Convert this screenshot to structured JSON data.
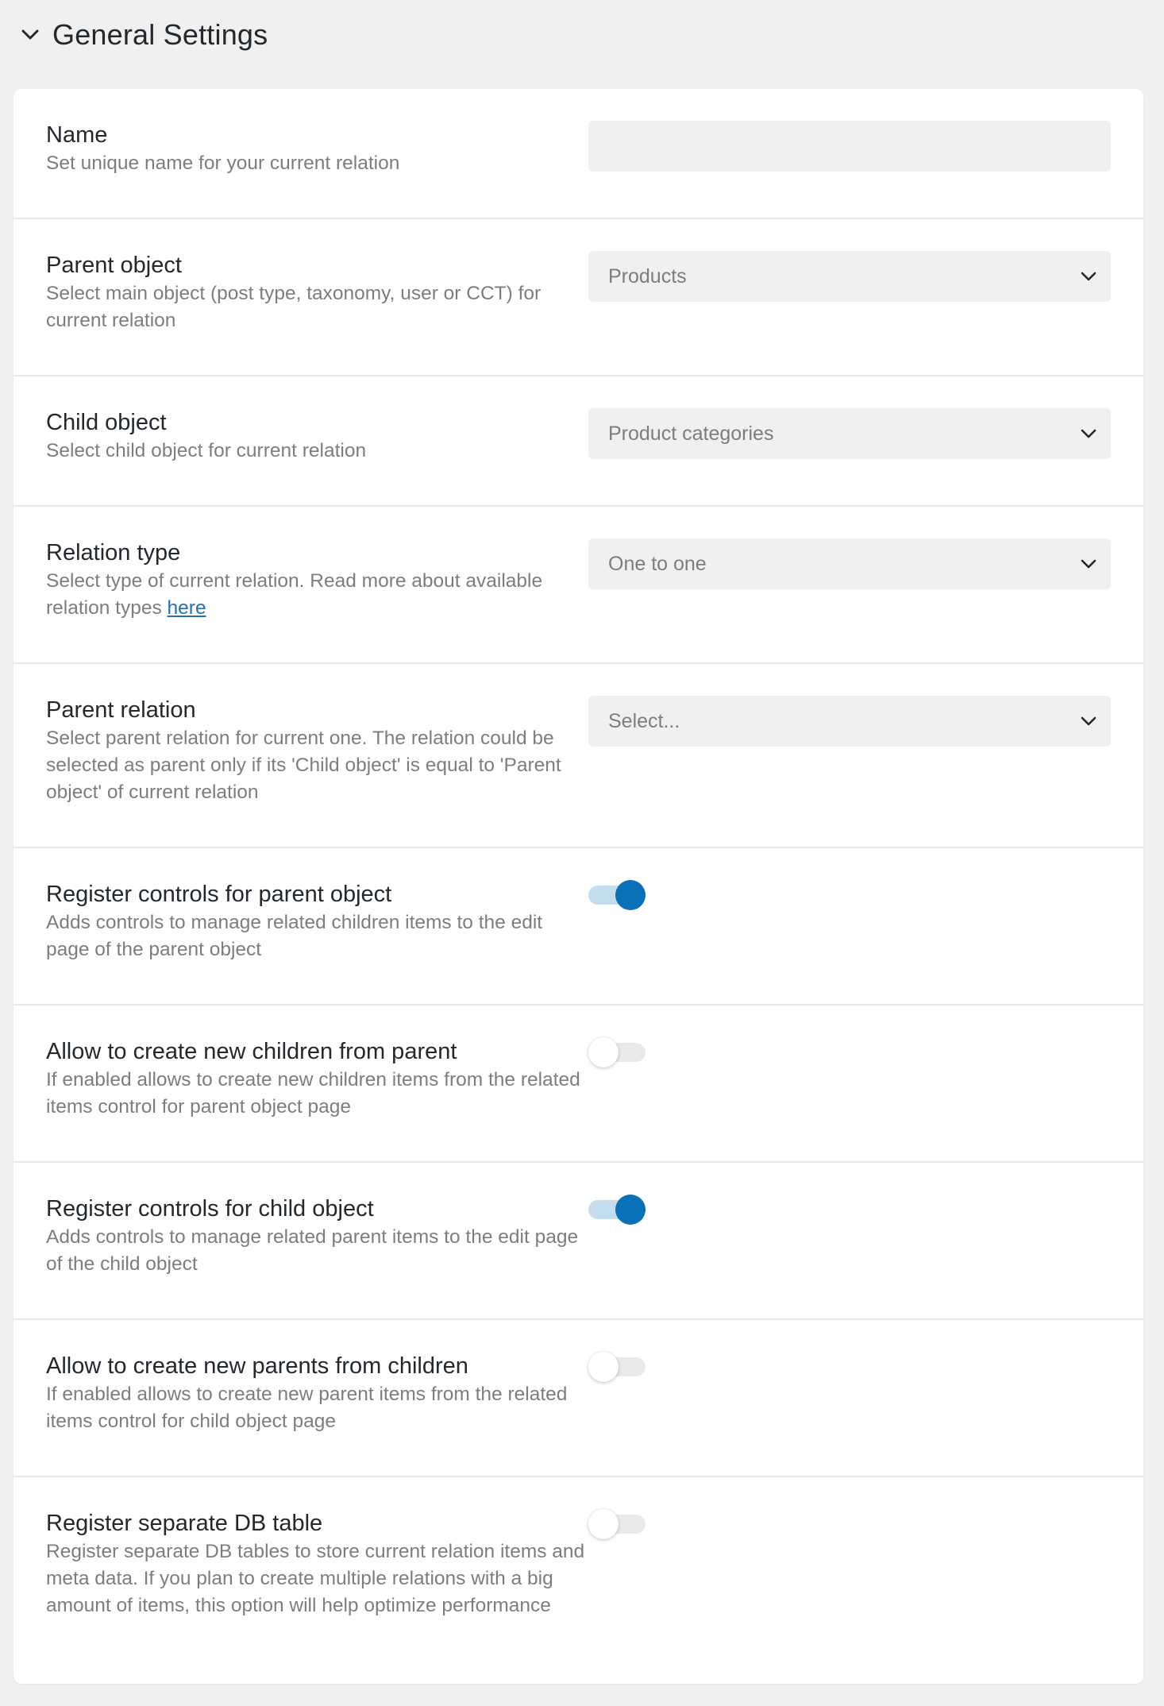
{
  "section": {
    "title": "General Settings"
  },
  "fields": {
    "name": {
      "title": "Name",
      "description": "Set unique name for your current relation",
      "value": ""
    },
    "parent_object": {
      "title": "Parent object",
      "description": "Select main object (post type, taxonomy, user or CCT) for current relation",
      "selected": "Products"
    },
    "child_object": {
      "title": "Child object",
      "description": "Select child object for current relation",
      "selected": "Product categories"
    },
    "relation_type": {
      "title": "Relation type",
      "description": "Select type of current relation. Read more about available relation types",
      "link_text": "here",
      "selected": "One to one"
    },
    "parent_relation": {
      "title": "Parent relation",
      "description": "Select parent relation for current one. The relation could be selected as parent only if its 'Child object' is equal to 'Parent object' of current relation",
      "selected": "Select..."
    },
    "register_parent_controls": {
      "title": "Register controls for parent object",
      "description": "Adds controls to manage related children items to the edit page of the parent object",
      "enabled": true
    },
    "create_children_from_parent": {
      "title": "Allow to create new children from parent",
      "description": "If enabled allows to create new children items from the related items control for parent object page",
      "enabled": false
    },
    "register_child_controls": {
      "title": "Register controls for child object",
      "description": "Adds controls to manage related parent items to the edit page of the child object",
      "enabled": true
    },
    "create_parents_from_children": {
      "title": "Allow to create new parents from children",
      "description": "If enabled allows to create new parent items from the related items control for child object page",
      "enabled": false
    },
    "register_db_table": {
      "title": "Register separate DB table",
      "description": "Register separate DB tables to store current relation items and meta data. If you plan to create multiple relations with a big amount of items, this option will help optimize performance",
      "enabled": false
    }
  },
  "colors": {
    "accent": "#0a70b8",
    "toggle_on_track": "#c4ddef",
    "toggle_off_track": "#eaeaea",
    "page_background": "#f0f0f1",
    "link": "#2271b1"
  },
  "icons": {
    "section_toggle": "chevron-down-icon",
    "select_arrow": "chevron-down-icon"
  }
}
